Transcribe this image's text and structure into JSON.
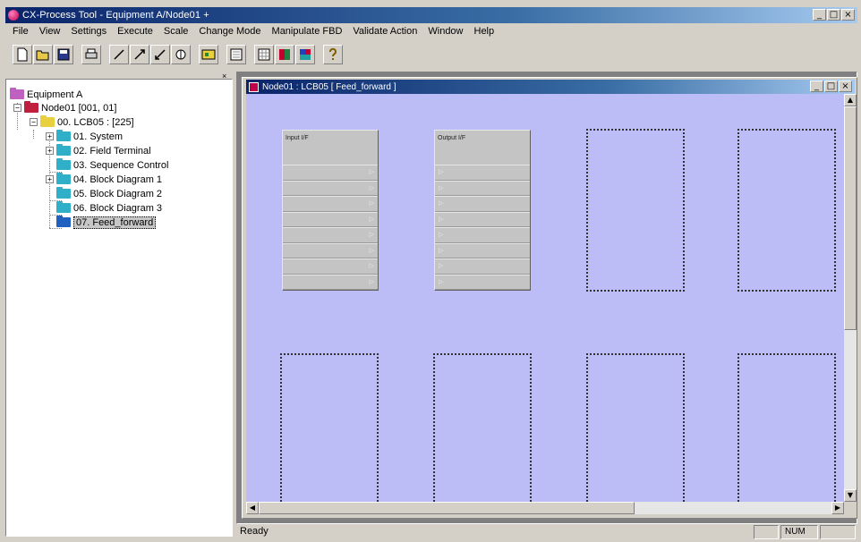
{
  "window": {
    "title": "CX-Process Tool - Equipment A/Node01 +",
    "controls": {
      "minimize": "_",
      "maximize": "□",
      "close": "×"
    }
  },
  "menu": [
    "File",
    "View",
    "Settings",
    "Execute",
    "Scale",
    "Change Mode",
    "Manipulate FBD",
    "Validate Action",
    "Window",
    "Help"
  ],
  "toolbar": {
    "icons": [
      "new-icon",
      "open-icon",
      "save-icon",
      "print-icon",
      "wire-icon",
      "wire-icon",
      "wire-icon",
      "tag-icon",
      "block-icon",
      "list-icon",
      "grid-icon",
      "color-icon",
      "color-icon",
      "help-icon"
    ]
  },
  "tree": {
    "root": "Equipment A",
    "node": "Node01 [001, 01]",
    "lcb": "00. LCB05 : [225]",
    "items": [
      {
        "label": "01. System",
        "expandable": true
      },
      {
        "label": "02. Field Terminal",
        "expandable": true
      },
      {
        "label": "03. Sequence Control",
        "expandable": false
      },
      {
        "label": "04. Block Diagram 1",
        "expandable": true
      },
      {
        "label": "05. Block Diagram 2",
        "expandable": false
      },
      {
        "label": "06. Block Diagram 3",
        "expandable": false
      },
      {
        "label": "07. Feed_forward",
        "expandable": false,
        "selected": true
      }
    ]
  },
  "child_window": {
    "title": "Node01 : LCB05 [ Feed_forward ]"
  },
  "blocks": {
    "input": {
      "title": "Input I/F"
    },
    "output": {
      "title": "Output I/F"
    }
  },
  "status": {
    "text": "Ready",
    "num": "NUM"
  },
  "colors": {
    "canvas": "#bcbcf6",
    "titlebar_start": "#0a246a",
    "titlebar_end": "#a6caf0"
  }
}
